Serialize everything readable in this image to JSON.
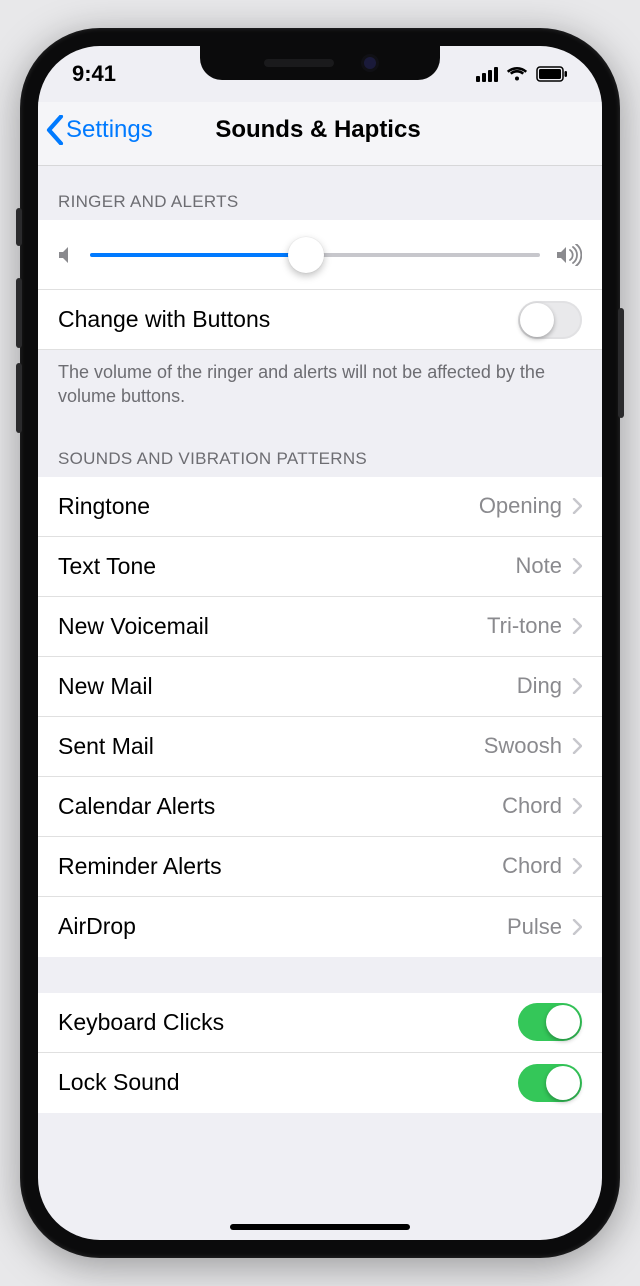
{
  "status": {
    "time": "9:41"
  },
  "nav": {
    "back": "Settings",
    "title": "Sounds & Haptics"
  },
  "sections": {
    "ringer": {
      "header": "RINGER AND ALERTS",
      "slider_percent": 48,
      "change_with_buttons": {
        "label": "Change with Buttons",
        "on": false
      },
      "footer": "The volume of the ringer and alerts will not be affected by the volume buttons."
    },
    "patterns": {
      "header": "SOUNDS AND VIBRATION PATTERNS",
      "items": [
        {
          "label": "Ringtone",
          "value": "Opening"
        },
        {
          "label": "Text Tone",
          "value": "Note"
        },
        {
          "label": "New Voicemail",
          "value": "Tri-tone"
        },
        {
          "label": "New Mail",
          "value": "Ding"
        },
        {
          "label": "Sent Mail",
          "value": "Swoosh"
        },
        {
          "label": "Calendar Alerts",
          "value": "Chord"
        },
        {
          "label": "Reminder Alerts",
          "value": "Chord"
        },
        {
          "label": "AirDrop",
          "value": "Pulse"
        }
      ]
    },
    "misc": {
      "keyboard_clicks": {
        "label": "Keyboard Clicks",
        "on": true
      },
      "lock_sound": {
        "label": "Lock Sound",
        "on": true
      }
    }
  }
}
